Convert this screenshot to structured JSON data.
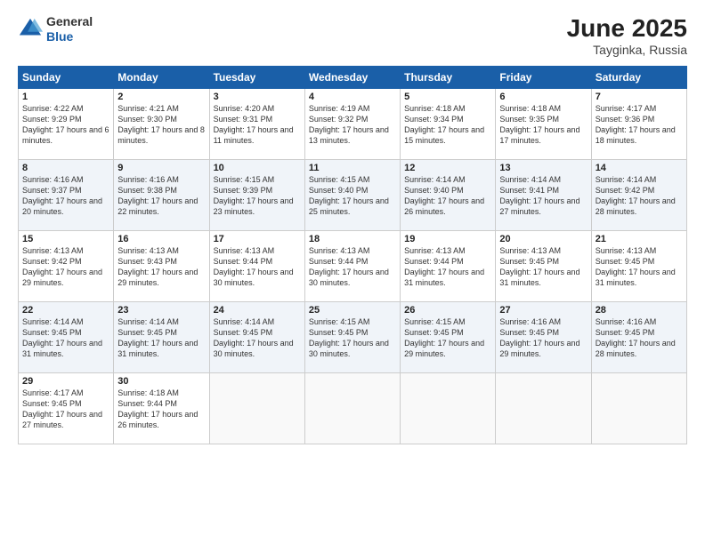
{
  "logo": {
    "general": "General",
    "blue": "Blue"
  },
  "title": {
    "month": "June 2025",
    "location": "Tayginka, Russia"
  },
  "headers": [
    "Sunday",
    "Monday",
    "Tuesday",
    "Wednesday",
    "Thursday",
    "Friday",
    "Saturday"
  ],
  "weeks": [
    [
      {
        "day": "1",
        "sunrise": "4:22 AM",
        "sunset": "9:29 PM",
        "daylight": "17 hours and 6 minutes."
      },
      {
        "day": "2",
        "sunrise": "4:21 AM",
        "sunset": "9:30 PM",
        "daylight": "17 hours and 8 minutes."
      },
      {
        "day": "3",
        "sunrise": "4:20 AM",
        "sunset": "9:31 PM",
        "daylight": "17 hours and 11 minutes."
      },
      {
        "day": "4",
        "sunrise": "4:19 AM",
        "sunset": "9:32 PM",
        "daylight": "17 hours and 13 minutes."
      },
      {
        "day": "5",
        "sunrise": "4:18 AM",
        "sunset": "9:34 PM",
        "daylight": "17 hours and 15 minutes."
      },
      {
        "day": "6",
        "sunrise": "4:18 AM",
        "sunset": "9:35 PM",
        "daylight": "17 hours and 17 minutes."
      },
      {
        "day": "7",
        "sunrise": "4:17 AM",
        "sunset": "9:36 PM",
        "daylight": "17 hours and 18 minutes."
      }
    ],
    [
      {
        "day": "8",
        "sunrise": "4:16 AM",
        "sunset": "9:37 PM",
        "daylight": "17 hours and 20 minutes."
      },
      {
        "day": "9",
        "sunrise": "4:16 AM",
        "sunset": "9:38 PM",
        "daylight": "17 hours and 22 minutes."
      },
      {
        "day": "10",
        "sunrise": "4:15 AM",
        "sunset": "9:39 PM",
        "daylight": "17 hours and 23 minutes."
      },
      {
        "day": "11",
        "sunrise": "4:15 AM",
        "sunset": "9:40 PM",
        "daylight": "17 hours and 25 minutes."
      },
      {
        "day": "12",
        "sunrise": "4:14 AM",
        "sunset": "9:40 PM",
        "daylight": "17 hours and 26 minutes."
      },
      {
        "day": "13",
        "sunrise": "4:14 AM",
        "sunset": "9:41 PM",
        "daylight": "17 hours and 27 minutes."
      },
      {
        "day": "14",
        "sunrise": "4:14 AM",
        "sunset": "9:42 PM",
        "daylight": "17 hours and 28 minutes."
      }
    ],
    [
      {
        "day": "15",
        "sunrise": "4:13 AM",
        "sunset": "9:42 PM",
        "daylight": "17 hours and 29 minutes."
      },
      {
        "day": "16",
        "sunrise": "4:13 AM",
        "sunset": "9:43 PM",
        "daylight": "17 hours and 29 minutes."
      },
      {
        "day": "17",
        "sunrise": "4:13 AM",
        "sunset": "9:44 PM",
        "daylight": "17 hours and 30 minutes."
      },
      {
        "day": "18",
        "sunrise": "4:13 AM",
        "sunset": "9:44 PM",
        "daylight": "17 hours and 30 minutes."
      },
      {
        "day": "19",
        "sunrise": "4:13 AM",
        "sunset": "9:44 PM",
        "daylight": "17 hours and 31 minutes."
      },
      {
        "day": "20",
        "sunrise": "4:13 AM",
        "sunset": "9:45 PM",
        "daylight": "17 hours and 31 minutes."
      },
      {
        "day": "21",
        "sunrise": "4:13 AM",
        "sunset": "9:45 PM",
        "daylight": "17 hours and 31 minutes."
      }
    ],
    [
      {
        "day": "22",
        "sunrise": "4:14 AM",
        "sunset": "9:45 PM",
        "daylight": "17 hours and 31 minutes."
      },
      {
        "day": "23",
        "sunrise": "4:14 AM",
        "sunset": "9:45 PM",
        "daylight": "17 hours and 31 minutes."
      },
      {
        "day": "24",
        "sunrise": "4:14 AM",
        "sunset": "9:45 PM",
        "daylight": "17 hours and 30 minutes."
      },
      {
        "day": "25",
        "sunrise": "4:15 AM",
        "sunset": "9:45 PM",
        "daylight": "17 hours and 30 minutes."
      },
      {
        "day": "26",
        "sunrise": "4:15 AM",
        "sunset": "9:45 PM",
        "daylight": "17 hours and 29 minutes."
      },
      {
        "day": "27",
        "sunrise": "4:16 AM",
        "sunset": "9:45 PM",
        "daylight": "17 hours and 29 minutes."
      },
      {
        "day": "28",
        "sunrise": "4:16 AM",
        "sunset": "9:45 PM",
        "daylight": "17 hours and 28 minutes."
      }
    ],
    [
      {
        "day": "29",
        "sunrise": "4:17 AM",
        "sunset": "9:45 PM",
        "daylight": "17 hours and 27 minutes."
      },
      {
        "day": "30",
        "sunrise": "4:18 AM",
        "sunset": "9:44 PM",
        "daylight": "17 hours and 26 minutes."
      },
      null,
      null,
      null,
      null,
      null
    ]
  ],
  "labels": {
    "sunrise": "Sunrise:",
    "sunset": "Sunset:",
    "daylight": "Daylight:"
  }
}
